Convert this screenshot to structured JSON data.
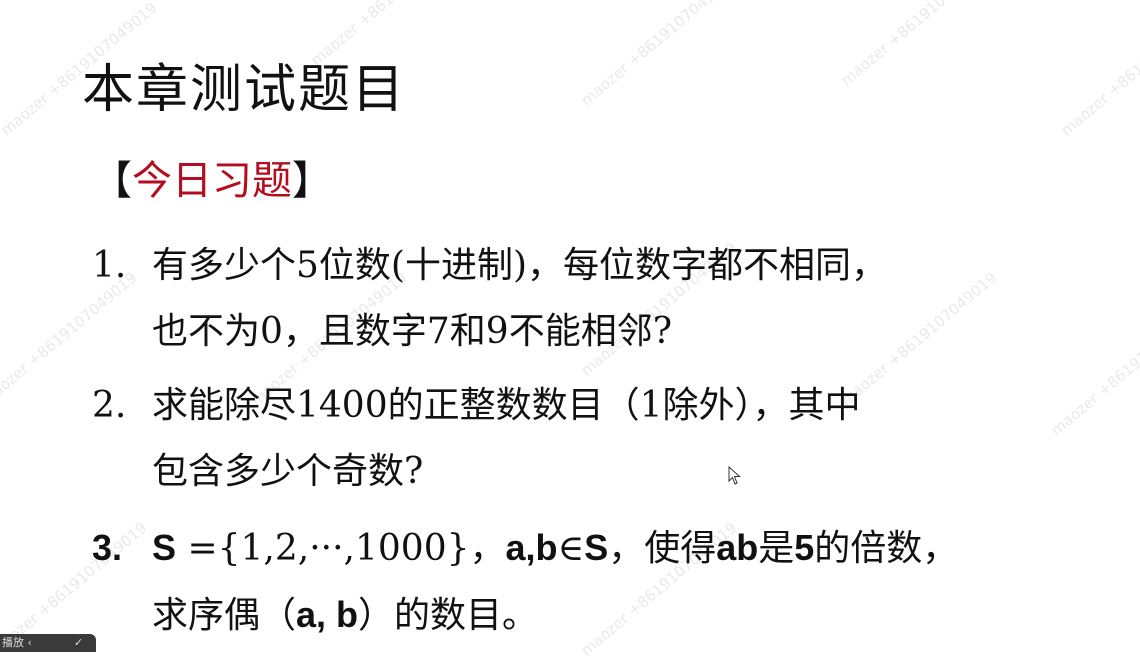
{
  "slide": {
    "title": "本章测试题目",
    "subheading": {
      "open": "【",
      "label": "今日习题",
      "close": "】"
    },
    "questions": [
      {
        "number": "1.",
        "line1": "有多少个5位数(十进制)，每位数字都不相同，",
        "line2": "也不为0，且数字7和9不能相邻?"
      },
      {
        "number": "2.",
        "line1": "求能除尽1400的正整数数目（1除外），其中",
        "line2": "包含多少个奇数?"
      },
      {
        "number": "3.",
        "line1_prefix": "S",
        "line1_set": " ={1,2,···,1000}，",
        "line1_ab": "a,b",
        "line1_in": "∈",
        "line1_s2": "S",
        "line1_mid": "，使得",
        "line1_ab2": "ab",
        "line1_is": "是",
        "line1_five": "5",
        "line1_end": "的倍数，",
        "line2_start": "求序偶（",
        "line2_ab": "a, b",
        "line2_end": "）的数目。"
      }
    ]
  },
  "watermark": {
    "text": "maozer +8619107049019"
  },
  "bottom_bar": {
    "label": "播放 ‹",
    "check": "✓"
  },
  "colors": {
    "accent_red": "#b30d1f",
    "text": "#111111",
    "background": "#ffffff"
  }
}
